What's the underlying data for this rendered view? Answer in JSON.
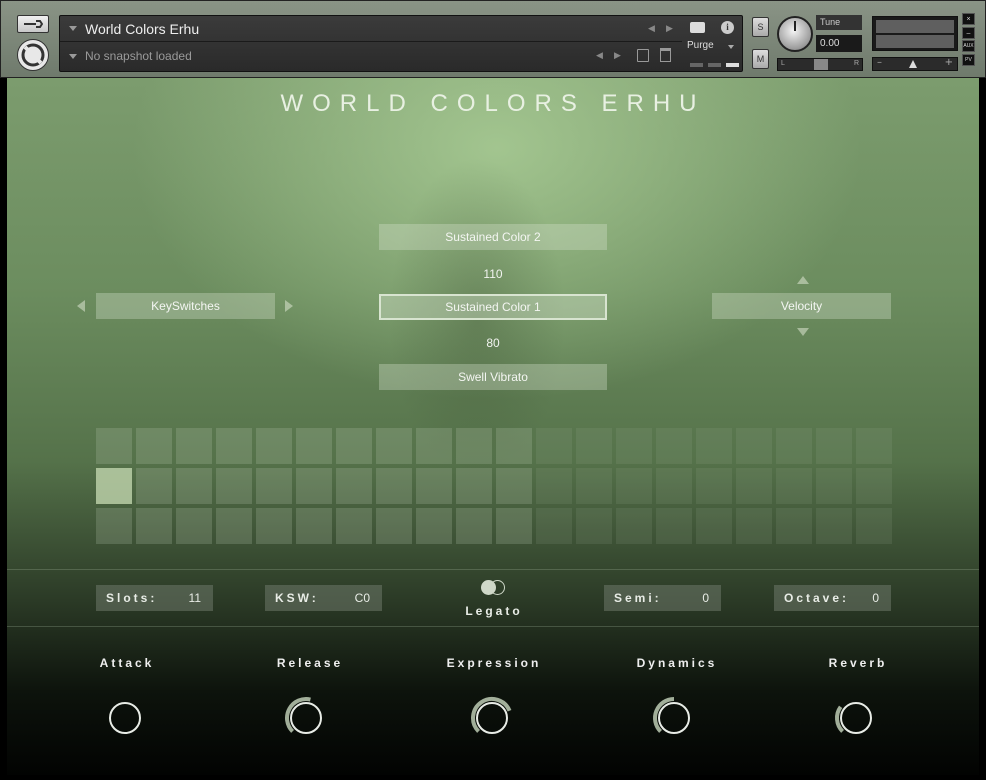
{
  "header": {
    "instrument_name": "World Colors Erhu",
    "snapshot": "No snapshot loaded",
    "purge_label": "Purge",
    "solo_label": "S",
    "mute_label": "M",
    "tune_label": "Tune",
    "tune_value": "0.00",
    "pan_left": "L",
    "pan_right": "R",
    "aux_label": "AUX",
    "pv_label": "PV",
    "close_label": "×",
    "minimize_label": "–",
    "vol_minus": "–",
    "vol_plus": "+"
  },
  "main": {
    "title": "WORLD COLORS ERHU",
    "keyswitch_label": "KeySwitches",
    "velocity_label": "Velocity",
    "articulations": {
      "top": "Sustained Color 2",
      "top_threshold": "110",
      "middle": "Sustained Color 1",
      "bottom_threshold": "80",
      "bottom": "Swell Vibrato"
    },
    "slots": {
      "columns": 20,
      "rows": 3,
      "filled_columns": 11,
      "active_index": 20
    },
    "params": {
      "slots_label": "Slots:",
      "slots_value": "11",
      "ksw_label": "KSW:",
      "ksw_value": "C0",
      "legato_label": "Legato",
      "semi_label": "Semi:",
      "semi_value": "0",
      "octave_label": "Octave:",
      "octave_value": "0"
    },
    "knobs": [
      {
        "label": "Attack",
        "value": 0.0
      },
      {
        "label": "Release",
        "value": 0.55
      },
      {
        "label": "Expression",
        "value": 0.75
      },
      {
        "label": "Dynamics",
        "value": 0.5
      },
      {
        "label": "Reverb",
        "value": 0.3
      }
    ]
  }
}
